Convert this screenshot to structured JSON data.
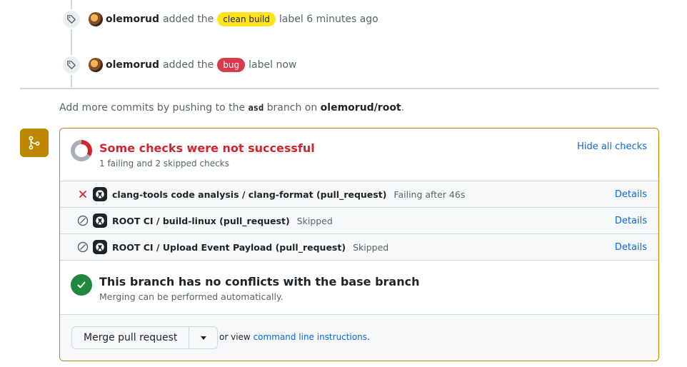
{
  "timeline": {
    "events": [
      {
        "author": "olemorud",
        "action": "added the",
        "label": "clean build",
        "suffix": "label 6 minutes ago"
      },
      {
        "author": "olemorud",
        "action": "added the",
        "label": "bug",
        "suffix": "label now"
      }
    ]
  },
  "push_note": {
    "prefix": "Add more commits by pushing to the",
    "branch": "asd",
    "middle": "branch on",
    "repo": "olemorud/root",
    "end": "."
  },
  "checks": {
    "title": "Some checks were not successful",
    "subtitle": "1 failing and 2 skipped checks",
    "hide_label": "Hide all checks",
    "rows": [
      {
        "name": "clang-tools code analysis / clang-format (pull_request)",
        "status": "Failing after 46s",
        "details": "Details",
        "state": "failed"
      },
      {
        "name": "ROOT CI / build-linux (pull_request)",
        "status": "Skipped",
        "details": "Details",
        "state": "skipped"
      },
      {
        "name": "ROOT CI / Upload Event Payload (pull_request)",
        "status": "Skipped",
        "details": "Details",
        "state": "skipped"
      }
    ]
  },
  "conflicts": {
    "title": "This branch has no conflicts with the base branch",
    "subtitle": "Merging can be performed automatically."
  },
  "merge": {
    "button_label": "Merge pull request",
    "or_view": "or view",
    "cli_link": "command line instructions",
    "end": "."
  },
  "colors": {
    "accent": "#bf8700",
    "danger": "#d1242f",
    "success": "#1f883d",
    "link": "#0969da"
  }
}
